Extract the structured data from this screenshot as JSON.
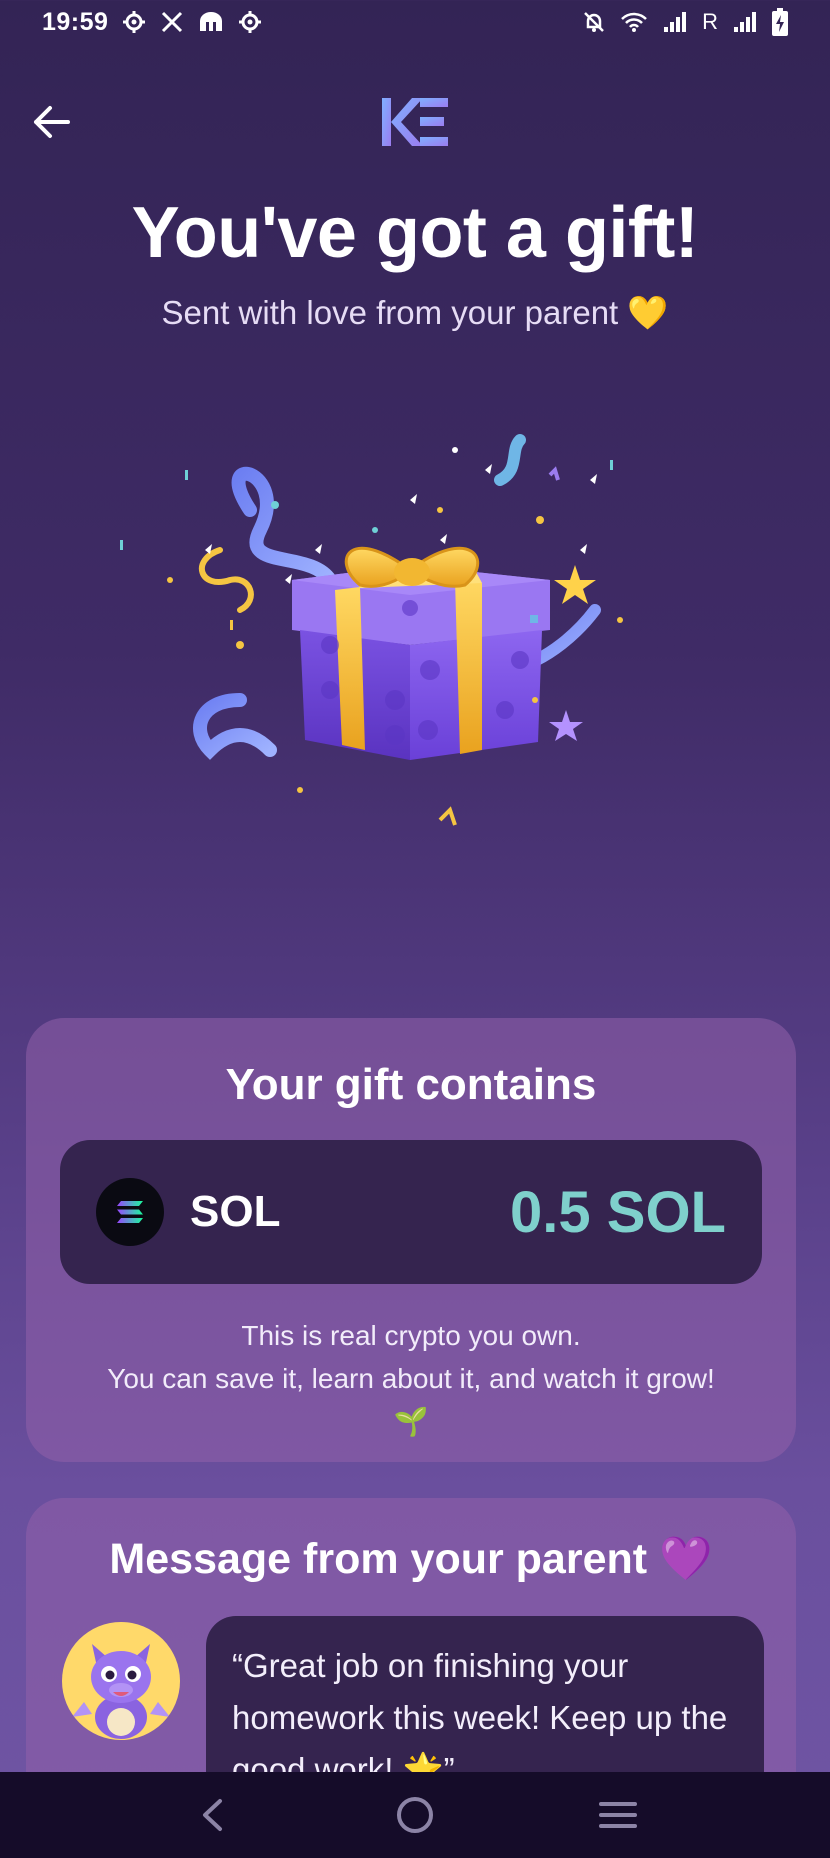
{
  "status_bar": {
    "time": "19:59",
    "left_icons": [
      "settings-icon",
      "x-logo-icon",
      "app-icon",
      "settings-icon"
    ],
    "right_icons": [
      "bell-off-icon",
      "wifi-icon",
      "signal-icon",
      "roaming-signal-icon",
      "battery-charging-icon"
    ],
    "roaming_label": "R"
  },
  "header": {
    "back_icon": "arrow-left-icon",
    "logo": "KE",
    "title": "You've got a gift!",
    "subtitle": "Sent with love from your parent 💛"
  },
  "illustration": {
    "icon": "gift-box-icon"
  },
  "gift_card": {
    "title": "Your gift contains",
    "token_icon": "solana-icon",
    "token_name": "SOL",
    "amount": "0.5 SOL",
    "desc_line1": "This is real crypto you own.",
    "desc_line2": "You can save it, learn about it, and watch it grow!",
    "desc_emoji": "🌱"
  },
  "message_card": {
    "title": "Message from your parent 💜",
    "avatar_icon": "dragon-avatar-icon",
    "message": "“Great job on finishing your homework this week! Keep up the good work! 🌟”"
  },
  "nav_bar": {
    "back_icon": "nav-back-icon",
    "home_icon": "nav-home-icon",
    "menu_icon": "nav-menu-icon"
  },
  "colors": {
    "background_top": "#332455",
    "background_bottom": "#6f55a4",
    "card": "#7a4f8f",
    "row": "#35244f",
    "accent_teal": "#7fd0cc",
    "gift_purple": "#8b5cf6",
    "ribbon_gold": "#f5c542"
  }
}
